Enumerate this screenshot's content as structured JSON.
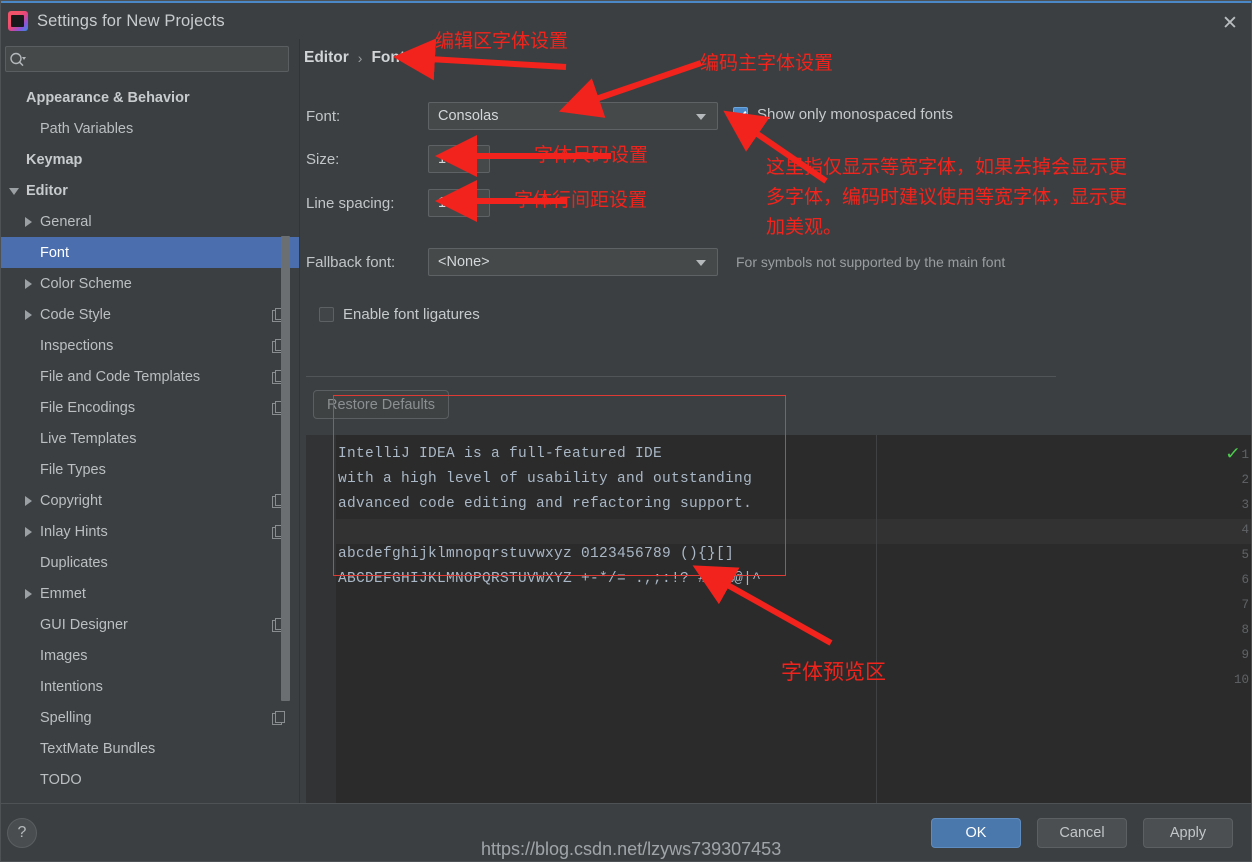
{
  "window": {
    "title": "Settings for New Projects",
    "app_icon": "intellij-idea-icon",
    "close_icon": "close-icon"
  },
  "sidebar": {
    "search": {
      "placeholder": "",
      "value": "",
      "icon": "search-icon"
    },
    "items": [
      {
        "label": "Appearance & Behavior",
        "indent": 0,
        "bold": true,
        "arrow": "none",
        "badge": false,
        "selected": false
      },
      {
        "label": "Path Variables",
        "indent": 1,
        "bold": false,
        "arrow": "none",
        "badge": false,
        "selected": false
      },
      {
        "label": "Keymap",
        "indent": 0,
        "bold": true,
        "arrow": "none",
        "badge": false,
        "selected": false
      },
      {
        "label": "Editor",
        "indent": 0,
        "bold": true,
        "arrow": "down",
        "badge": false,
        "selected": false
      },
      {
        "label": "General",
        "indent": 1,
        "bold": false,
        "arrow": "right",
        "badge": false,
        "selected": false
      },
      {
        "label": "Font",
        "indent": 1,
        "bold": false,
        "arrow": "none",
        "badge": false,
        "selected": true
      },
      {
        "label": "Color Scheme",
        "indent": 1,
        "bold": false,
        "arrow": "right",
        "badge": false,
        "selected": false
      },
      {
        "label": "Code Style",
        "indent": 1,
        "bold": false,
        "arrow": "right",
        "badge": true,
        "selected": false
      },
      {
        "label": "Inspections",
        "indent": 1,
        "bold": false,
        "arrow": "none",
        "badge": true,
        "selected": false
      },
      {
        "label": "File and Code Templates",
        "indent": 1,
        "bold": false,
        "arrow": "none",
        "badge": true,
        "selected": false
      },
      {
        "label": "File Encodings",
        "indent": 1,
        "bold": false,
        "arrow": "none",
        "badge": true,
        "selected": false
      },
      {
        "label": "Live Templates",
        "indent": 1,
        "bold": false,
        "arrow": "none",
        "badge": false,
        "selected": false
      },
      {
        "label": "File Types",
        "indent": 1,
        "bold": false,
        "arrow": "none",
        "badge": false,
        "selected": false
      },
      {
        "label": "Copyright",
        "indent": 1,
        "bold": false,
        "arrow": "right",
        "badge": true,
        "selected": false
      },
      {
        "label": "Inlay Hints",
        "indent": 1,
        "bold": false,
        "arrow": "right",
        "badge": true,
        "selected": false
      },
      {
        "label": "Duplicates",
        "indent": 1,
        "bold": false,
        "arrow": "none",
        "badge": false,
        "selected": false
      },
      {
        "label": "Emmet",
        "indent": 1,
        "bold": false,
        "arrow": "right",
        "badge": false,
        "selected": false
      },
      {
        "label": "GUI Designer",
        "indent": 1,
        "bold": false,
        "arrow": "none",
        "badge": true,
        "selected": false
      },
      {
        "label": "Images",
        "indent": 1,
        "bold": false,
        "arrow": "none",
        "badge": false,
        "selected": false
      },
      {
        "label": "Intentions",
        "indent": 1,
        "bold": false,
        "arrow": "none",
        "badge": false,
        "selected": false
      },
      {
        "label": "Spelling",
        "indent": 1,
        "bold": false,
        "arrow": "none",
        "badge": true,
        "selected": false
      },
      {
        "label": "TextMate Bundles",
        "indent": 1,
        "bold": false,
        "arrow": "none",
        "badge": false,
        "selected": false
      },
      {
        "label": "TODO",
        "indent": 1,
        "bold": false,
        "arrow": "none",
        "badge": false,
        "selected": false
      }
    ]
  },
  "breadcrumb": {
    "parent": "Editor",
    "separator": "›",
    "current": "Font"
  },
  "form": {
    "font_label": "Font:",
    "font_value": "Consolas",
    "size_label": "Size:",
    "size_value": "13",
    "line_spacing_label": "Line spacing:",
    "line_spacing_value": "1.2",
    "fallback_label": "Fallback font:",
    "fallback_value": "<None>",
    "fallback_hint": "For symbols not supported by the main font",
    "monospaced_label": "Show only monospaced fonts",
    "monospaced_checked": true,
    "ligatures_label": "Enable font ligatures",
    "ligatures_checked": false,
    "restore_defaults_label": "Restore Defaults"
  },
  "preview": {
    "lines": [
      "IntelliJ IDEA is a full-featured IDE",
      "with a high level of usability and outstanding",
      "advanced code editing and refactoring support.",
      "",
      "abcdefghijklmnopqrstuvwxyz 0123456789 (){}[]",
      "ABCDEFGHIJKLMNOPQRSTUVWXYZ +-*/= .,;:!? #&$%@|^",
      "",
      "",
      "",
      ""
    ],
    "gutter_numbers": [
      "1",
      "2",
      "3",
      "4",
      "5",
      "6",
      "7",
      "8",
      "9",
      "10"
    ],
    "status_icon": "green-check-icon"
  },
  "footer": {
    "help_label": "?",
    "ok_label": "OK",
    "cancel_label": "Cancel",
    "apply_label": "Apply"
  },
  "annotations": [
    {
      "name": "annotation-editor-font-setting",
      "text": "编辑区字体设置"
    },
    {
      "name": "annotation-main-font-setting",
      "text": "编码主字体设置"
    },
    {
      "name": "annotation-font-size-setting",
      "text": "字体尺码设置"
    },
    {
      "name": "annotation-line-spacing-setting",
      "text": "字体行间距设置"
    },
    {
      "name": "annotation-monospaced-note-1",
      "text": "这里指仅显示等宽字体，如果去掉会显示更"
    },
    {
      "name": "annotation-monospaced-note-2",
      "text": "多字体，编码时建议使用等宽字体，显示更"
    },
    {
      "name": "annotation-monospaced-note-3",
      "text": "加美观。"
    },
    {
      "name": "annotation-preview-area",
      "text": "字体预览区"
    }
  ],
  "watermark": {
    "text": "https://blog.csdn.net/lzyws739307453"
  },
  "colors": {
    "accent": "#4b6eaf",
    "annotation": "#f2231c",
    "window_bg": "#3c3f41",
    "editor_bg": "#2b2b2b",
    "primary_button": "#4a78ad",
    "status_ok": "#4ec94e"
  }
}
